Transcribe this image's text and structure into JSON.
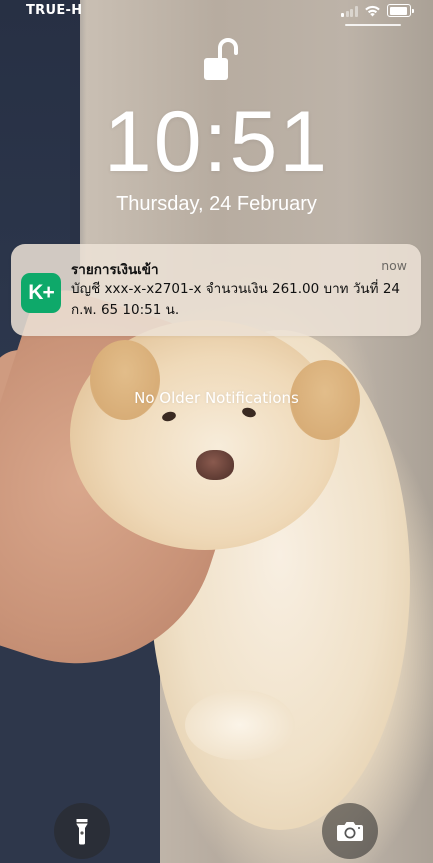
{
  "status_bar": {
    "carrier": "TRUE-H"
  },
  "lock_screen": {
    "time": "10:51",
    "date": "Thursday, 24 February",
    "lock_icon": "unlocked-padlock-icon"
  },
  "notification": {
    "app_icon_label": "K+",
    "app_icon_color": "#0ea96a",
    "title": "รายการเงินเข้า",
    "time": "now",
    "body": "บัญชี xxx-x-x2701-x  จำนวนเงิน 261.00 บาท  วันที่ 24 ก.พ. 65  10:51 น."
  },
  "no_older_notifications": "No Older Notifications",
  "quick_actions": {
    "flashlight_icon": "flashlight-icon",
    "camera_icon": "camera-icon"
  }
}
